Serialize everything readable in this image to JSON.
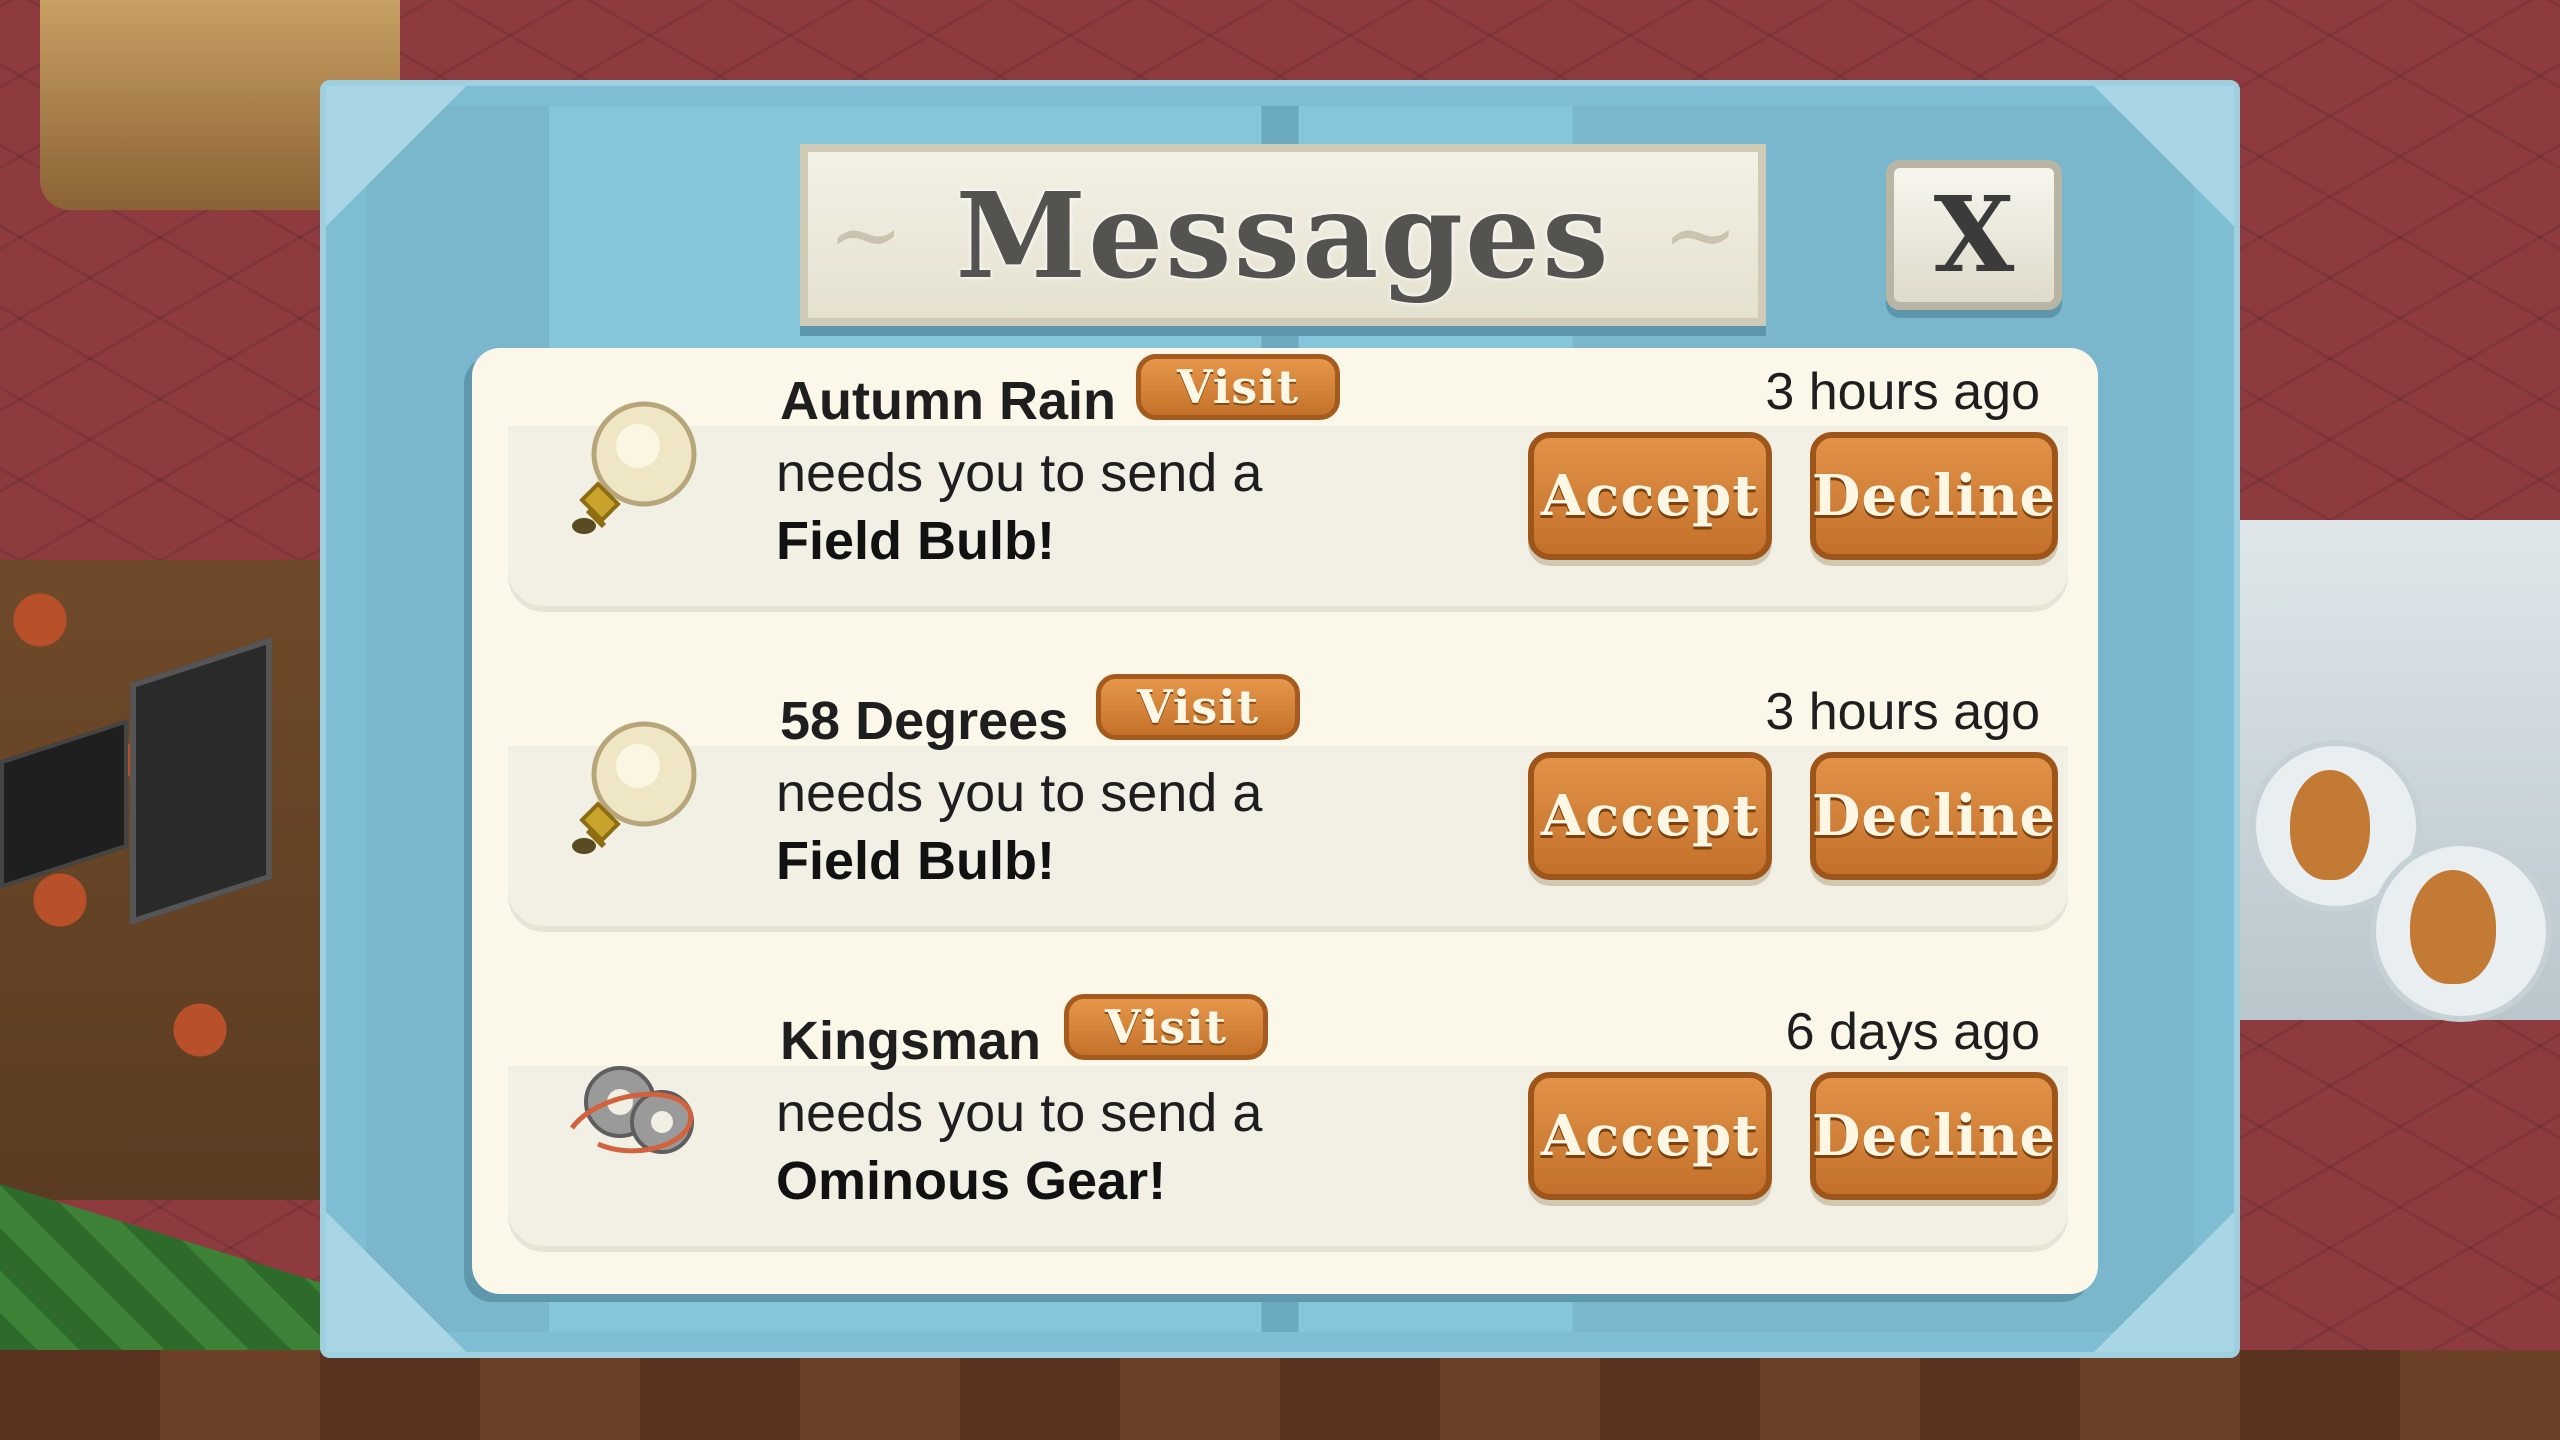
{
  "dialog": {
    "title": "Messages",
    "close_label": "X"
  },
  "messages": [
    {
      "sender": "Autumn Rain",
      "visit_label": "Visit",
      "time": "3 hours ago",
      "request": "needs you to send a",
      "item": "Field Bulb!",
      "icon": "lightbulb-icon",
      "accept_label": "Accept",
      "decline_label": "Decline"
    },
    {
      "sender": "58 Degrees",
      "visit_label": "Visit",
      "time": "3 hours ago",
      "request": "needs you to send a",
      "item": "Field Bulb!",
      "icon": "lightbulb-icon",
      "accept_label": "Accept",
      "decline_label": "Decline"
    },
    {
      "sender": "Kingsman",
      "visit_label": "Visit",
      "time": "6 days ago",
      "request": "needs you to send a",
      "item": "Ominous Gear!",
      "icon": "gear-icon",
      "accept_label": "Accept",
      "decline_label": "Decline"
    }
  ],
  "colors": {
    "dialog_frame": "#7fbdd4",
    "panel": "#fbf8ea",
    "button_orange": "#d4823a"
  }
}
